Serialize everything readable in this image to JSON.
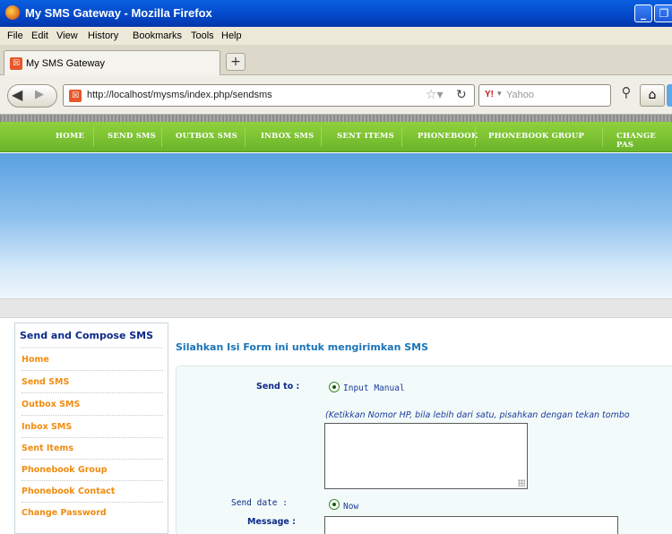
{
  "window": {
    "title": "My SMS Gateway - Mozilla Firefox"
  },
  "menu": [
    "File",
    "Edit",
    "View",
    "History",
    "Bookmarks",
    "Tools",
    "Help"
  ],
  "tab": {
    "label": "My SMS Gateway",
    "new_tab": "+"
  },
  "address": {
    "url": "http://localhost/mysms/index.php/sendsms"
  },
  "search": {
    "engine": "Y!",
    "placeholder": "Yahoo"
  },
  "nav": [
    "HOME",
    "SEND SMS",
    "OUTBOX SMS",
    "INBOX SMS",
    "SENT ITEMS",
    "PHONEBOOK",
    "PHONEBOOK GROUP",
    "CHANGE PAS"
  ],
  "sidebar": {
    "title": "Send and Compose SMS",
    "items": [
      "Home",
      "Send SMS",
      "Outbox SMS",
      "Inbox SMS",
      "Sent Items",
      "Phonebook Group",
      "Phonebook Contact",
      "Change Password"
    ]
  },
  "main": {
    "heading": "Silahkan Isi Form ini untuk mengirimkan SMS",
    "send_to_label": "Send to :",
    "send_to_option": "Input Manual",
    "note": "(Ketikkan Nomor HP, bila lebih dari satu, pisahkan dengan tekan tombo",
    "send_date_label": "Send date :",
    "send_date_option": "Now",
    "message_label": "Message :"
  },
  "colors": {
    "nav_green": "#7cc334",
    "menu_orange": "#f08c10",
    "heading_blue": "#1a74b8"
  }
}
